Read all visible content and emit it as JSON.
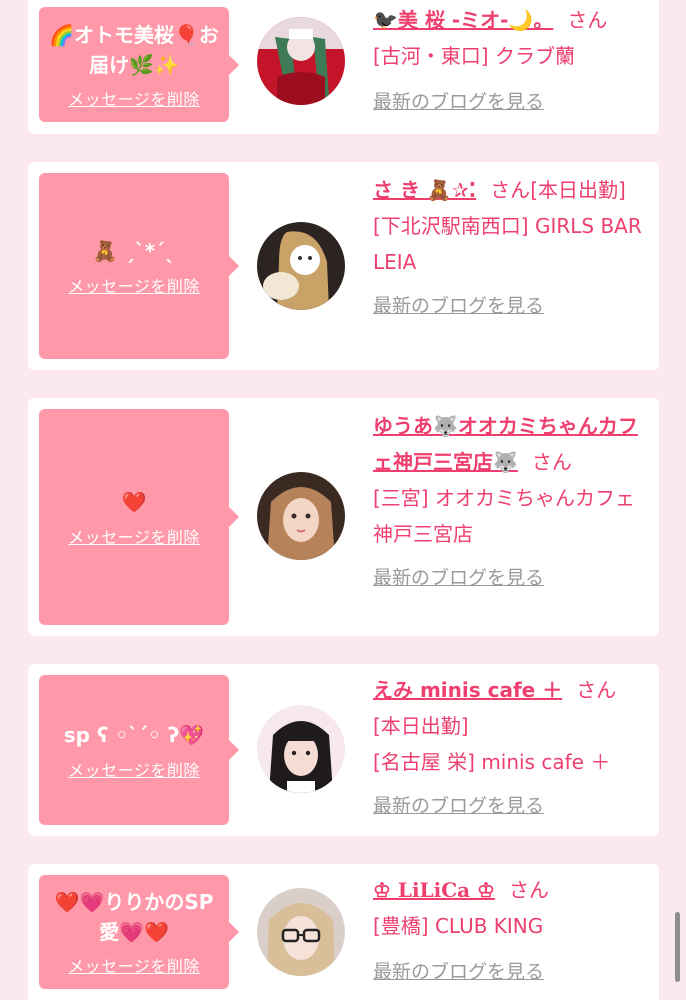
{
  "colors": {
    "page_bg": "#fbe9ee",
    "message_bg": "#ff98a8",
    "name_pink": "#ee3f6e",
    "blog_gray": "#9a9a9a"
  },
  "delete_label": "メッセージを削除",
  "blog_label": "最新のブログを見る",
  "san": "さん",
  "cards": [
    {
      "message": "🌈オトモ美桜🎈お届け🌿✨",
      "name": "🐦‍⬛美 桜 -ミオ-🌙。",
      "location_line": "[古河・東口] クラブ蘭",
      "status": ""
    },
    {
      "message": "🧸 ˏˋ*ˊˎ",
      "name": "さ き 🧸✰⁚",
      "status": "[本日出勤]",
      "location_line": "[下北沢駅南西口] GIRLS BAR LEIA"
    },
    {
      "message": "❤️",
      "name": "ゆうあ🐺オオカミちゃんカフェ神戸三宮店🐺",
      "location_line": "[三宮] オオカミちゃんカフェ神戸三宮店",
      "status": ""
    },
    {
      "message": "sp ʕ ◦`ˊ◦ ʔ💖",
      "name": "えみ minis cafe ＋",
      "status": "[本日出勤]",
      "location_line": "[名古屋 栄] minis cafe ＋"
    },
    {
      "message": "❤️💗りりかのSP愛💗❤️",
      "name": "♔ LiLiCa ♔",
      "location_line": "[豊橋] CLUB KING",
      "status": ""
    }
  ]
}
